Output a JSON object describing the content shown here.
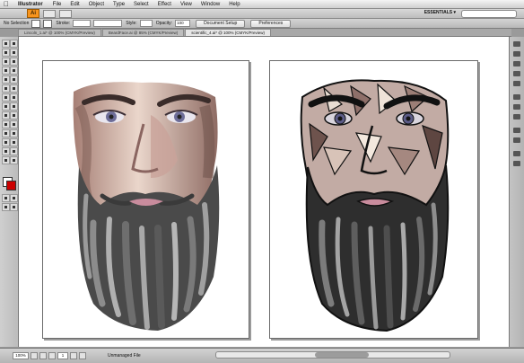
{
  "menubar": {
    "apple": "",
    "app_name": "Illustrator",
    "items": [
      "File",
      "Edit",
      "Object",
      "Type",
      "Select",
      "Effect",
      "View",
      "Window",
      "Help"
    ]
  },
  "appbar": {
    "logo": "Ai",
    "workspace": "ESSENTIALS ▾"
  },
  "control": {
    "selection": "No Selection",
    "stroke_label": "Stroke:",
    "style_label": "Style:",
    "opacity_label": "Opacity:",
    "opacity_value": "100",
    "document_setup": "Document Setup",
    "preferences": "Preferences"
  },
  "tabs": [
    {
      "label": "Lincoln_1.ai* @ 100% (CMYK/Preview)",
      "active": false
    },
    {
      "label": "BeardFace.ai @ 85% (CMYK/Preview)",
      "active": false
    },
    {
      "label": "scientific_4.ai* @ 100% (CMYK/Preview)",
      "active": true
    }
  ],
  "status": {
    "zoom": "100%",
    "page": "1",
    "info": "Unmanaged File"
  },
  "colors": {
    "logo": "#f7941d",
    "skin_light": "#e9d3c8",
    "skin_mid": "#c9a29a",
    "skin_shadow": "#8d6e66",
    "beard_dark": "#3b3b3b",
    "beard_mid": "#6e6e6e",
    "beard_light": "#9c9c9c",
    "lips": "#c98c9d",
    "eyes": "#6d6d98"
  },
  "icons": {
    "apple": "apple-icon",
    "search": "search-icon",
    "zoom_arrow": "chevron-down-icon"
  }
}
